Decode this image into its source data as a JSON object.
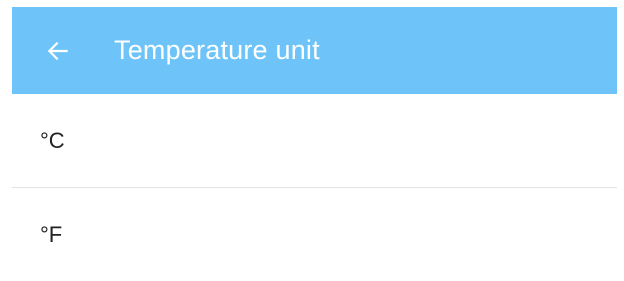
{
  "appbar": {
    "title": "Temperature unit",
    "back_icon": "arrow-left-icon",
    "background_color": "#6ec4f8"
  },
  "options": [
    {
      "label": "°C"
    },
    {
      "label": "°F"
    }
  ]
}
